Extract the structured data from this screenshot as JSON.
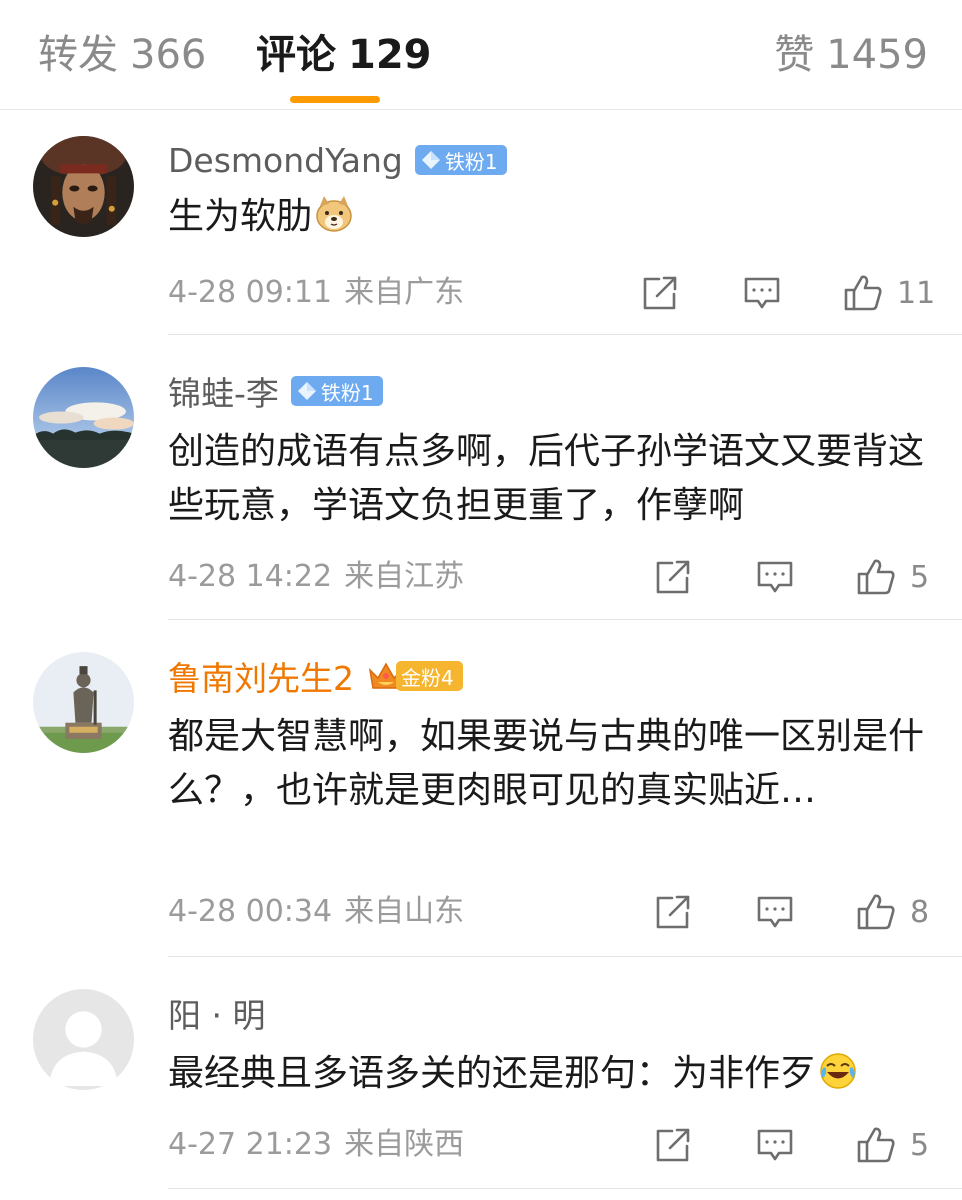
{
  "tabs": {
    "reposts": {
      "label": "转发",
      "count": "366"
    },
    "comments": {
      "label": "评论",
      "count": "129"
    },
    "likes": {
      "label": "赞",
      "count": "1459"
    }
  },
  "colors": {
    "accent": "#ff9a00",
    "username": "#5d5d5d",
    "gold_username": "#f07800",
    "iron_badge": "#6eaaf0",
    "gold_badge": "#f6b52e",
    "meta": "#9b9b9b"
  },
  "comments": [
    {
      "username": "DesmondYang",
      "badge": "铁粉1",
      "text": "生为软肋",
      "emoji": "doge-emoji",
      "date": "4-28 09:11",
      "location": "来自广东",
      "likes": "11"
    },
    {
      "username": "锦蛙-李",
      "badge": "铁粉1",
      "text": "创造的成语有点多啊，后代子孙学语文又要背这些玩意，学语文负担更重了，作孽啊",
      "date": "4-28 14:22",
      "location": "来自江苏",
      "likes": "5"
    },
    {
      "username": "鲁南刘先生2",
      "badge": "金粉4",
      "text": "都是大智慧啊，如果要说与古典的唯一区别是什么？，也许就是更肉眼可见的真实贴近…",
      "date": "4-28 00:34",
      "location": "来自山东",
      "likes": "8"
    },
    {
      "username": "阳 · 明",
      "text": "最经典且多语多关的还是那句：为非作歹",
      "emoji": "laugh-cry-emoji",
      "date": "4-27 21:23",
      "location": "来自陕西",
      "likes": "5"
    }
  ]
}
